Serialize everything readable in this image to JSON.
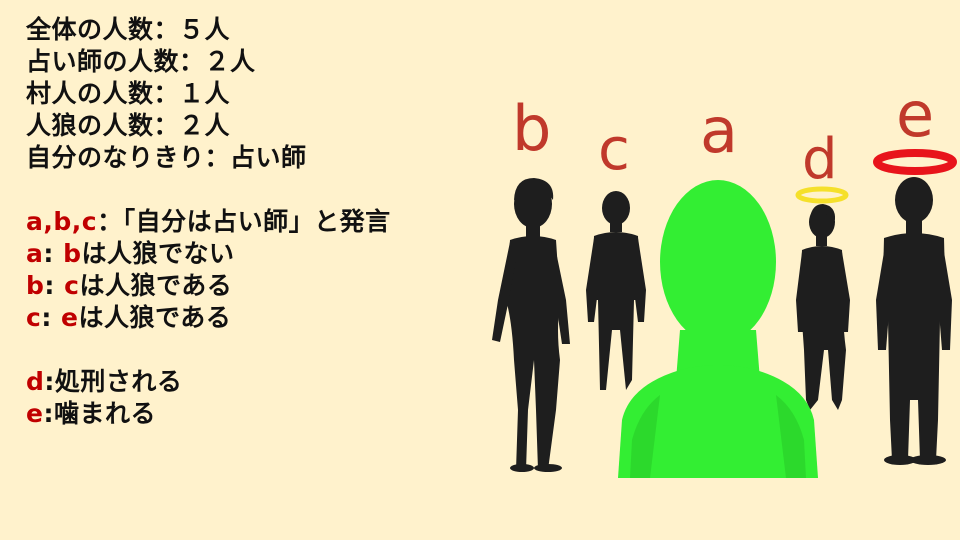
{
  "rules": {
    "total": "全体の人数：５人",
    "seers": "占い師の人数：２人",
    "villagers": "村人の人数：１人",
    "werewolves": "人狼の人数：２人",
    "role": "自分のなりきり：占い師"
  },
  "claims": {
    "who": "a,b,c",
    "who_rest": "：「自分は占い師」と発言",
    "a_key": "a",
    "a_target": "b",
    "a_rest": "は人狼でない",
    "b_key": "b",
    "b_target": "c",
    "b_rest": "は人狼である",
    "c_key": "c",
    "c_target": "e",
    "c_rest": "は人狼である"
  },
  "events": {
    "d_key": "d",
    "d_rest": ":処刑される",
    "e_key": "e",
    "e_rest": ":噛まれる"
  },
  "scene": {
    "labels": [
      "b",
      "c",
      "a",
      "d",
      "e"
    ],
    "colors": {
      "background": "#fff2cc",
      "accent_red": "#c00000",
      "label_red": "#c0392b",
      "figure_dark": "#1e1e1e",
      "figure_green": "#33ee33",
      "halo_gold": "#f5e02a",
      "halo_red": "#e8141b"
    }
  }
}
